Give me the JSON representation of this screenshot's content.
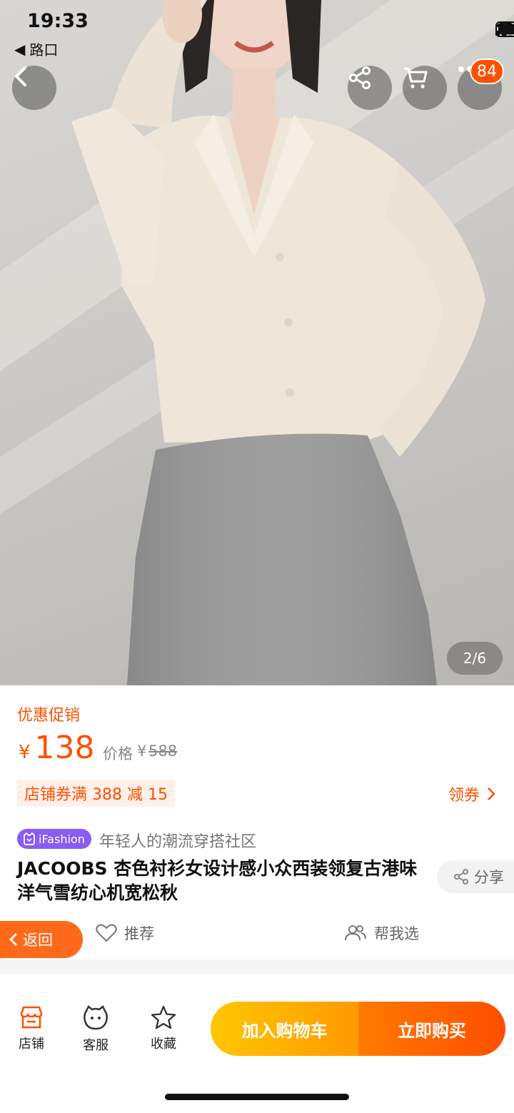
{
  "status_bar": {
    "time": "19:33",
    "back_app": "路口"
  },
  "top_bar": {
    "cart_badge": "84"
  },
  "gallery": {
    "indicator": "2/6"
  },
  "promo": {
    "label": "优惠促销",
    "currency": "¥",
    "price": "138",
    "original_label": "价格",
    "original_currency": "¥",
    "original_price": "588"
  },
  "coupon": {
    "text": "店铺券满 388 减 15",
    "get_label": "领券"
  },
  "ifashion": {
    "tag": "iFashion",
    "subtitle": "年轻人的潮流穿搭社区"
  },
  "product": {
    "title": "JACOOBS 杏色衬衫女设计感小众西装领复古港味洋气雪纺心机宽松秋"
  },
  "share": {
    "label": "分享"
  },
  "float_back": {
    "label": "返回"
  },
  "actions": {
    "recommend": "推荐",
    "help_choose": "帮我选"
  },
  "bottom_bar": {
    "shop": "店铺",
    "service": "客服",
    "favorite": "收藏",
    "add_cart": "加入购物车",
    "buy_now": "立即购买"
  },
  "colors": {
    "accent": "#ff5000",
    "cart_gradient_start": "#ffc600",
    "buy_gradient_end": "#ff4e00",
    "ifashion_purple": "#8a5cf5"
  }
}
